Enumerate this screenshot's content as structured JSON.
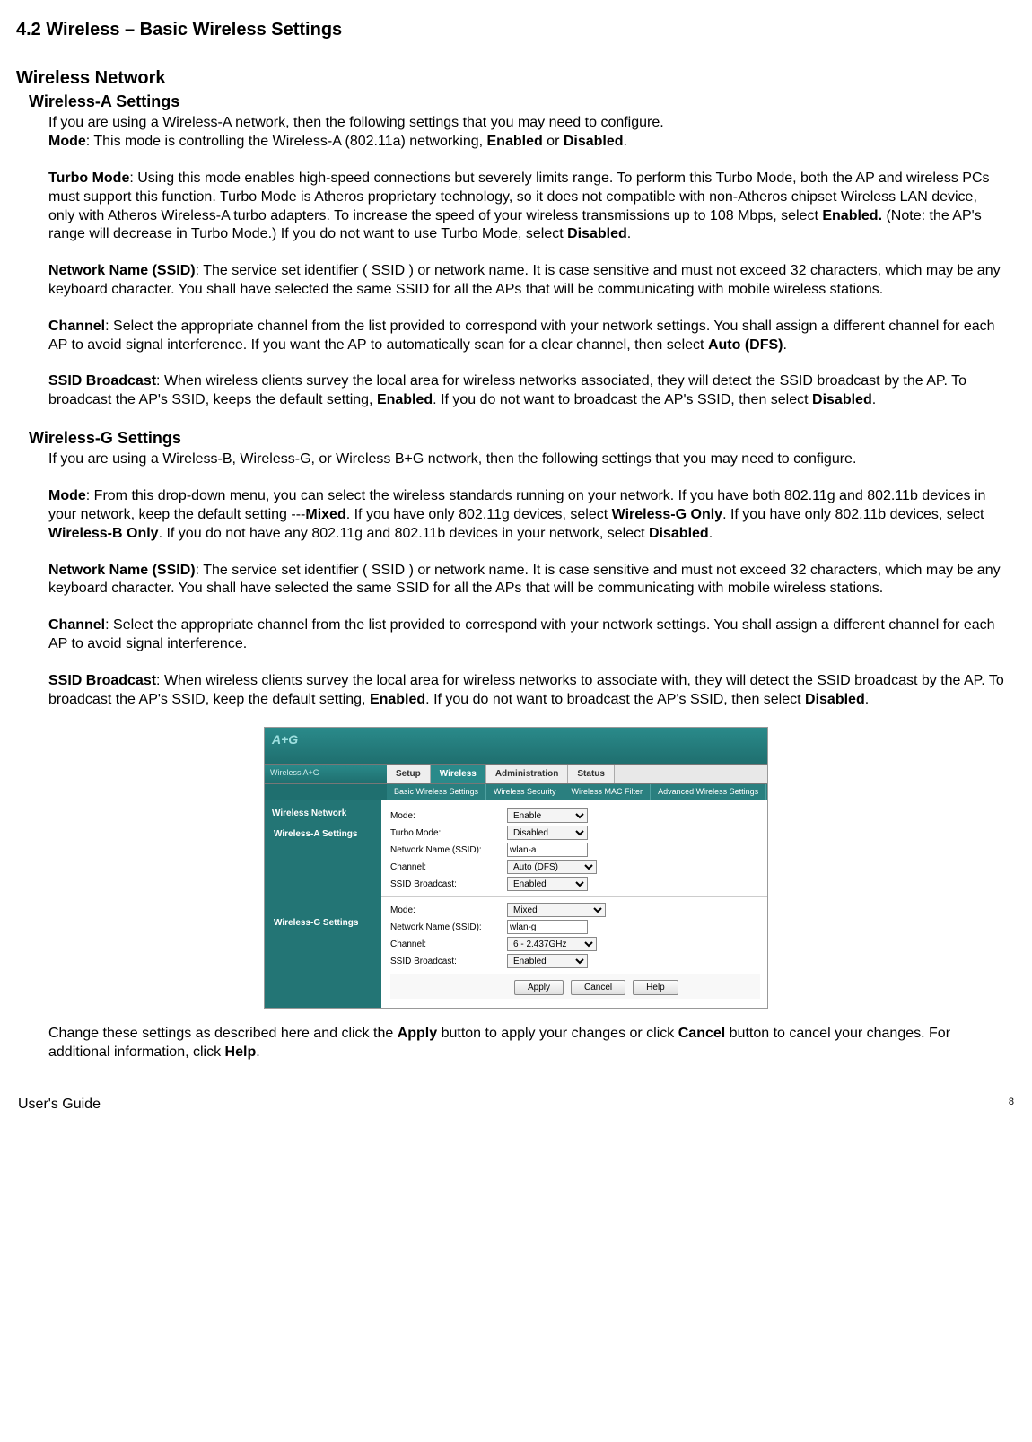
{
  "title": "4.2 Wireless – Basic Wireless Settings",
  "heading_network": "Wireless Network",
  "sections": {
    "a": {
      "title": "Wireless-A Settings",
      "intro": "If you are using a Wireless-A network, then the following settings that you may need to configure.",
      "mode_label": "Mode",
      "mode_text": ": This mode is controlling the Wireless-A (802.11a) networking, ",
      "mode_opt1": "Enabled",
      "mode_or": " or ",
      "mode_opt2": "Disabled",
      "turbo_label": "Turbo Mode",
      "turbo_text1": ": Using this mode enables high-speed connections but severely limits range. To perform this Turbo Mode, both the AP and wireless PCs must support this function. Turbo Mode is Atheros proprietary technology, so it does not compatible with non-Atheros chipset Wireless LAN device, only with Atheros Wireless-A turbo adapters. To increase the speed of your wireless transmissions up to 108 Mbps, select ",
      "turbo_bold1": "Enabled.",
      "turbo_text2": " (Note: the AP's range will decrease in Turbo Mode.) If you do not want to use Turbo Mode, select ",
      "turbo_bold2": "Disabled",
      "ssid_label": "Network Name (SSID)",
      "ssid_text": ": The service set identifier ( SSID ) or network name. It is case sensitive and must not exceed 32 characters, which may be any keyboard character. You shall have selected the same SSID for all the APs that will be communicating with mobile wireless stations.",
      "chan_label": "Channel",
      "chan_text1": ": Select the appropriate channel from the list provided to correspond with your network settings. You shall assign a different channel for each AP to avoid signal interference. If you want the AP to automatically scan for a clear channel, then select ",
      "chan_bold": "Auto (DFS)",
      "bcast_label": "SSID Broadcast",
      "bcast_text1": ": When wireless clients survey the local area for wireless networks associated, they will detect the SSID broadcast by the AP. To broadcast the AP's SSID, keeps the default setting, ",
      "bcast_bold1": "Enabled",
      "bcast_text2": ". If you do not want to broadcast the AP's SSID, then select ",
      "bcast_bold2": "Disabled"
    },
    "g": {
      "title": "Wireless-G Settings",
      "intro": "If you are using a Wireless-B, Wireless-G, or Wireless B+G network, then the following settings that you may need to configure.",
      "mode_label": "Mode",
      "mode_text1": ": From this drop-down menu, you can select the wireless standards running on your network. If you have both 802.11g and 802.11b devices in your network, keep the default setting ---",
      "mode_b1": "Mixed",
      "mode_text2": ". If you have only 802.11g devices, select ",
      "mode_b2": "Wireless-G Only",
      "mode_text3": ". If you have only 802.11b devices, select ",
      "mode_b3": "Wireless-B Only",
      "mode_text4": ". If you do not have any 802.11g and 802.11b devices in your network, select ",
      "mode_b4": "Disabled",
      "ssid_label": "Network Name (SSID)",
      "ssid_text": ": The service set identifier ( SSID ) or network name. It is case sensitive and must not exceed 32 characters, which may be any keyboard character. You shall have selected the same SSID for all the APs that will be communicating with mobile wireless stations.",
      "chan_label": "Channel",
      "chan_text": ": Select the appropriate channel from the list provided to correspond with your network settings. You shall assign a different channel for each AP to avoid signal interference.",
      "bcast_label": "SSID Broadcast",
      "bcast_text1": ": When wireless clients survey the local area for wireless networks to associate with, they will detect the SSID broadcast by the AP. To broadcast the AP's SSID, keep the default setting, ",
      "bcast_bold1": "Enabled",
      "bcast_text2": ". If you do not want to broadcast the AP's SSID, then select ",
      "bcast_bold2": "Disabled"
    }
  },
  "closing1": "Change these settings as described here and click the ",
  "closing_b1": "Apply",
  "closing2": " button to apply your changes or click ",
  "closing_b2": "Cancel",
  "closing3": " button to cancel your changes. For additional information, click ",
  "closing_b3": "Help",
  "ui": {
    "brand": "Wireless A+G",
    "tabs": [
      "Setup",
      "Wireless",
      "Administration",
      "Status"
    ],
    "subtabs": [
      "Basic Wireless Settings",
      "Wireless Security",
      "Wireless MAC Filter",
      "Advanced Wireless Settings"
    ],
    "side_header": "Wireless Network",
    "groupA": "Wireless-A Settings",
    "groupG": "Wireless-G Settings",
    "labels": {
      "mode": "Mode:",
      "turbo": "Turbo Mode:",
      "ssid": "Network Name (SSID):",
      "channel": "Channel:",
      "bcast": "SSID Broadcast:"
    },
    "valuesA": {
      "mode": "Enable",
      "turbo": "Disabled",
      "ssid": "wlan-a",
      "channel": "Auto (DFS)",
      "bcast": "Enabled"
    },
    "valuesG": {
      "mode": "Mixed",
      "ssid": "wlan-g",
      "channel": "6 - 2.437GHz",
      "bcast": "Enabled"
    },
    "buttons": {
      "apply": "Apply",
      "cancel": "Cancel",
      "help": "Help"
    }
  },
  "footer": {
    "guide": "User's Guide",
    "page": "8"
  }
}
